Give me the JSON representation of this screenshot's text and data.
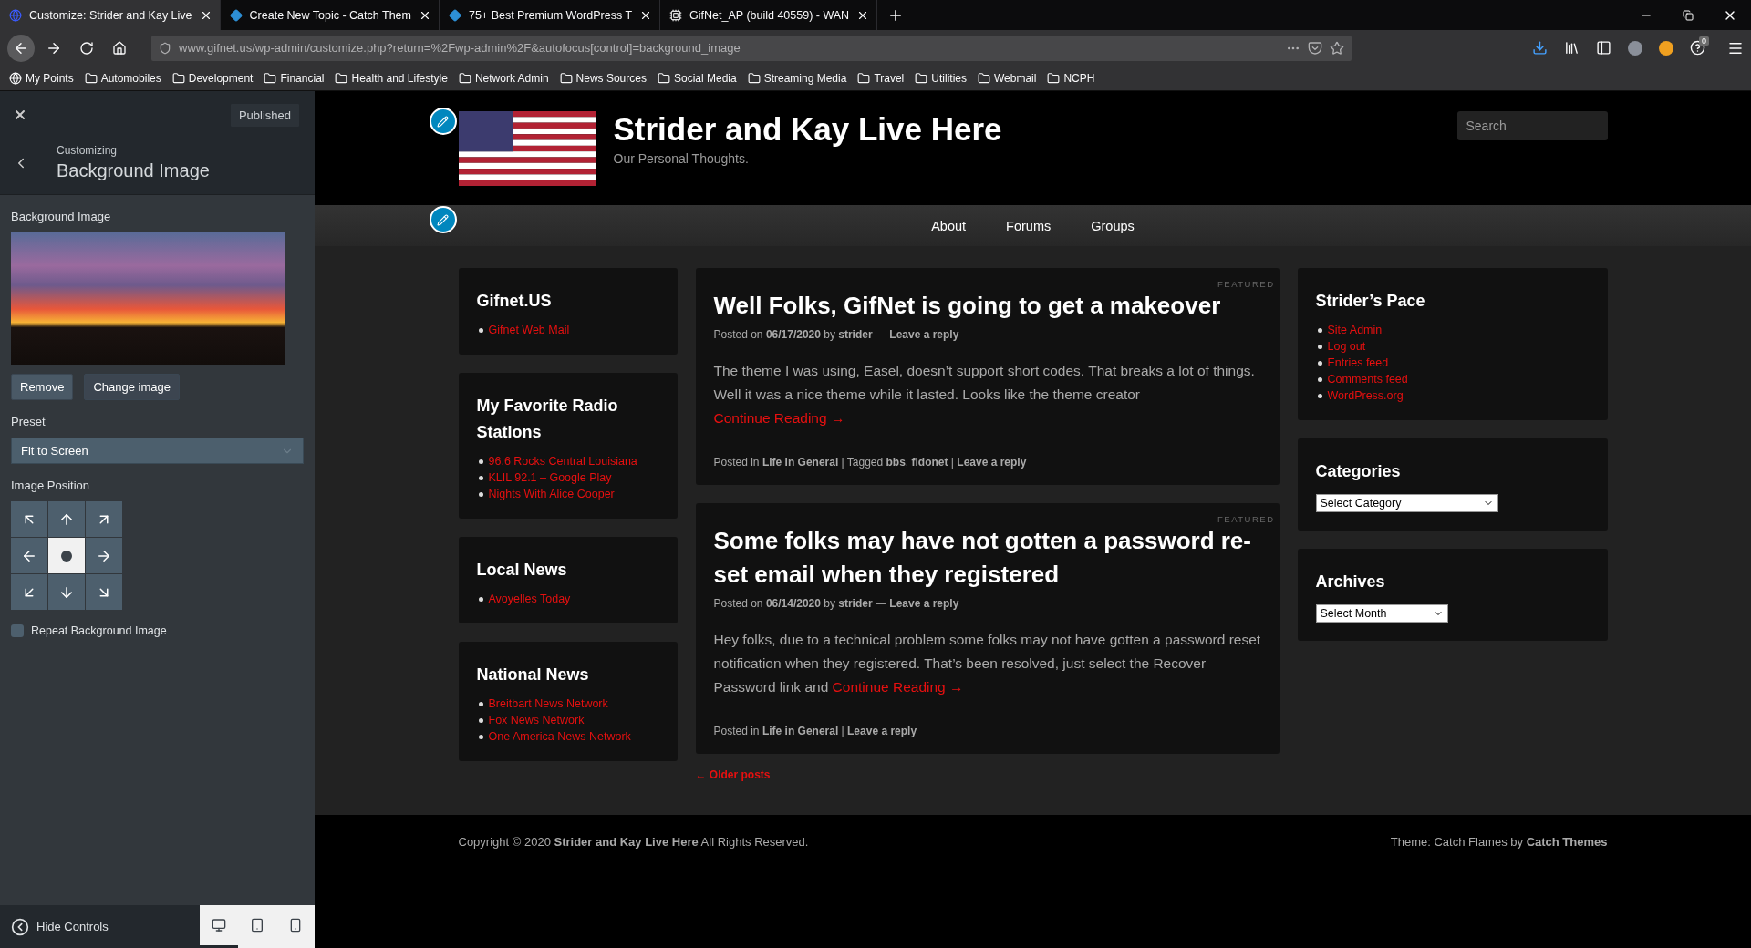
{
  "browser": {
    "tabs": [
      {
        "title": "Customize: Strider and Kay Live",
        "kind": "site",
        "selected": true
      },
      {
        "title": "Create New Topic - Catch Them",
        "kind": "diamond",
        "selected": false
      },
      {
        "title": "75+ Best Premium WordPress T",
        "kind": "diamond",
        "selected": false
      },
      {
        "title": "GifNet_AP (build 40559) - WAN",
        "kind": "device",
        "selected": false
      }
    ],
    "url": "www.gifnet.us/wp-admin/customize.php?return=%2Fwp-admin%2F&autofocus[control]=background_image",
    "extension_badge": "0",
    "bookmarks": [
      {
        "label": "My Points",
        "kind": "globe"
      },
      {
        "label": "Automobiles",
        "kind": "folder"
      },
      {
        "label": "Development",
        "kind": "folder"
      },
      {
        "label": "Financial",
        "kind": "folder"
      },
      {
        "label": "Health and Lifestyle",
        "kind": "folder"
      },
      {
        "label": "Network Admin",
        "kind": "folder"
      },
      {
        "label": "News Sources",
        "kind": "folder"
      },
      {
        "label": "Social Media",
        "kind": "folder"
      },
      {
        "label": "Streaming Media",
        "kind": "folder"
      },
      {
        "label": "Travel",
        "kind": "folder"
      },
      {
        "label": "Utilities",
        "kind": "folder"
      },
      {
        "label": "Webmail",
        "kind": "folder"
      },
      {
        "label": "NCPH",
        "kind": "folder"
      }
    ]
  },
  "customizer": {
    "publish_button": "Published",
    "breadcrumb": "Customizing",
    "section_title": "Background Image",
    "image_label": "Background Image",
    "buttons": [
      "Remove",
      "Change image"
    ],
    "preset_label": "Preset",
    "preset_value": "Fit to Screen",
    "position_label": "Image Position",
    "positions": [
      {
        "selected": false
      },
      {
        "selected": false
      },
      {
        "selected": false
      },
      {
        "selected": false
      },
      {
        "selected": true
      },
      {
        "selected": false
      },
      {
        "selected": false
      },
      {
        "selected": false
      },
      {
        "selected": false
      }
    ],
    "repeat": {
      "label": "Repeat Background Image",
      "checked": false
    },
    "hide_controls": "Hide Controls",
    "devices": [
      {
        "kind": "desktop",
        "selected": true
      },
      {
        "kind": "tablet",
        "selected": false
      },
      {
        "kind": "mobile",
        "selected": false
      }
    ]
  },
  "site": {
    "title": "Strider and Kay Live Here",
    "tagline": "Our Personal Thoughts.",
    "search_placeholder": "Search",
    "menu": [
      "About",
      "Forums",
      "Groups"
    ],
    "left_widgets": [
      {
        "title": "Gifnet.US",
        "links": [
          "Gifnet Web Mail"
        ]
      },
      {
        "title": "My Favorite Radio Stations",
        "links": [
          "96.6 Rocks Central Louisiana",
          "KLIL 92.1 – Google Play",
          "Nights With Alice Cooper"
        ]
      },
      {
        "title": "Local News",
        "links": [
          "Avoyelles Today"
        ]
      },
      {
        "title": "National News",
        "links": [
          "Breitbart News Network",
          "Fox News Network",
          "One America News Network"
        ]
      }
    ],
    "posts": [
      {
        "badge": "FEATURED",
        "title": "Well Folks, GifNet is going to get a makeover",
        "meta": "Posted on **06/17/2020** by **strider** — **Leave a reply**",
        "excerpt": "The theme I was using, Easel, doesn’t support short codes. That breaks a lot of things. Well it was a nice theme while it lasted. Looks like the theme creator",
        "more": "Continue Reading →",
        "footer": "Posted in **Life in General** | Tagged **bbs**, **fidonet** | **Leave a reply**"
      },
      {
        "badge": "FEATURED",
        "title": "Some folks may have not gotten a password re-set email when they registered",
        "meta": "Posted on **06/14/2020** by **strider** — **Leave a reply**",
        "excerpt": "Hey folks, due to a technical problem some folks may not have gotten a password reset notification when they registered. That’s been resolved, just select the Recover Password link and",
        "more": "Continue Reading →",
        "footer": "Posted in **Life in General** | **Leave a reply**"
      }
    ],
    "older_posts": "← Older posts",
    "right_widgets": [
      {
        "title": "Strider’s Pace",
        "kind": "links",
        "links": [
          "Site Admin",
          "Log out",
          "Entries feed",
          "Comments feed",
          "WordPress.org"
        ]
      },
      {
        "title": "Categories",
        "kind": "select",
        "value": "Select Category"
      },
      {
        "title": "Archives",
        "kind": "select",
        "value": "Select Month"
      }
    ],
    "copyright": "Copyright © 2020 **Strider and Kay Live Here** All Rights Reserved.",
    "credit": "Theme: Catch Flames by **Catch Themes**"
  }
}
